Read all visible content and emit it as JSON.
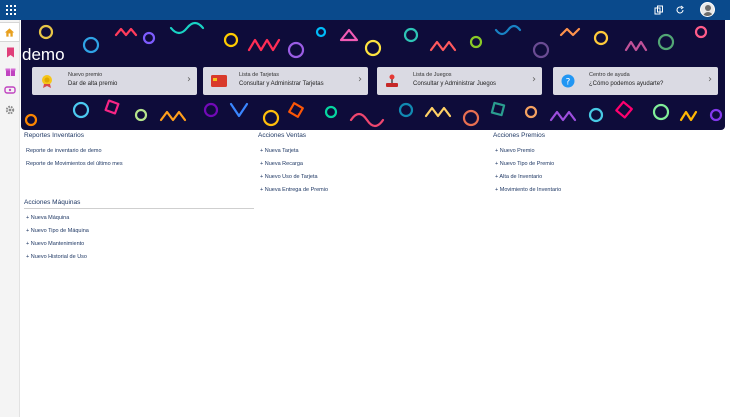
{
  "header": {
    "icons": [
      "waffle-icon",
      "copy-icon",
      "refresh-icon",
      "user-avatar-icon"
    ]
  },
  "sidebar": {
    "items": [
      {
        "name": "home-icon",
        "color": "#e8a01e"
      },
      {
        "name": "bookmark-icon",
        "color": "#e0407a"
      },
      {
        "name": "gift-icon",
        "color": "#c044c0"
      },
      {
        "name": "ticket-icon",
        "color": "#c044c0"
      },
      {
        "name": "gear-icon",
        "color": "#8a8a8a"
      }
    ]
  },
  "banner": {
    "title": "demo",
    "cards": [
      {
        "title": "Nuevo premio",
        "subtitle": "Dar de alta premio",
        "icon": "prize-icon"
      },
      {
        "title": "Lista de Tarjetas",
        "subtitle": "Consultar y Administrar Tarjetas",
        "icon": "card-icon"
      },
      {
        "title": "Lista de Juegos",
        "subtitle": "Consultar y Administrar Juegos",
        "icon": "joystick-icon"
      },
      {
        "title": "Centro de ayuda",
        "subtitle": "¿Cómo podemos ayudarte?",
        "icon": "help-icon"
      }
    ]
  },
  "sections": {
    "reportes": {
      "title": "Reportes Inventarios",
      "links": [
        "Reporte de inventario de demo",
        "Reporte de Movimientos del último mes"
      ]
    },
    "ventas": {
      "title": "Acciones Ventas",
      "links": [
        "+ Nueva Tarjeta",
        "+ Nueva Recarga",
        "+ Nuevo Uso de Tarjeta",
        "+ Nueva Entrega de Premio"
      ]
    },
    "premios": {
      "title": "Acciones Premios",
      "links": [
        "+ Nuevo Premio",
        "+ Nuevo Tipo de Premio",
        "+ Alta de Inventario",
        "+ Movimiento de Inventario"
      ]
    },
    "maquinas": {
      "title": "Acciones Máquinas",
      "links": [
        "+ Nueva Máquina",
        "+ Nuevo Tipo de Máquina",
        "+ Nuevo Mantenimiento",
        "+ Nuevo Historial de Uso"
      ]
    }
  }
}
